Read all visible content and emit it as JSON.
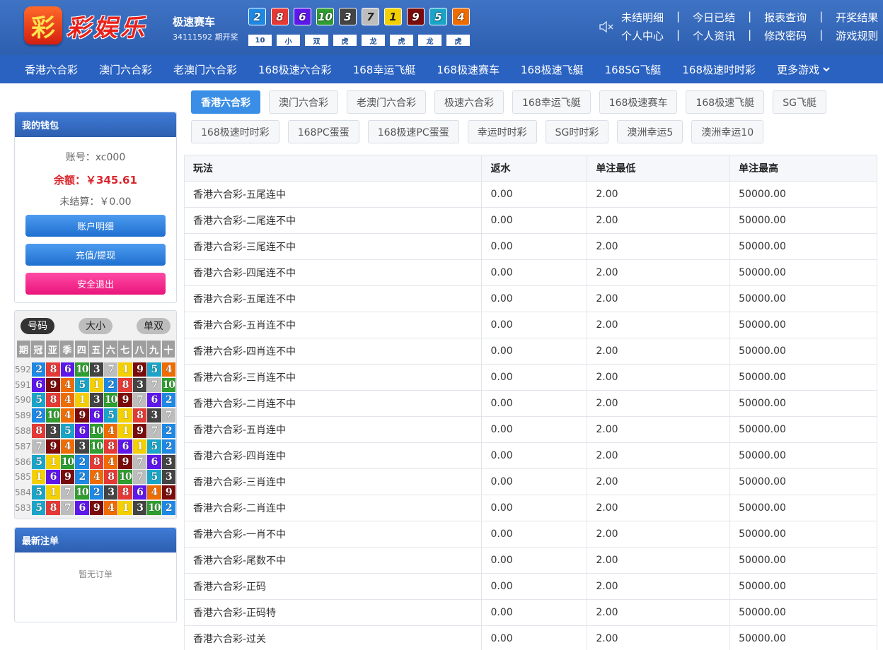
{
  "header": {
    "logo_char": "彩",
    "logo_text": "彩娱乐",
    "game_title": "极速赛车",
    "issue_text": "34111592 期开奖",
    "balls": [
      {
        "n": "2",
        "c": "#1e88e5"
      },
      {
        "n": "8",
        "c": "#e53935"
      },
      {
        "n": "6",
        "c": "#5e17eb"
      },
      {
        "n": "10",
        "c": "#2e9e2e"
      },
      {
        "n": "3",
        "c": "#444444"
      },
      {
        "n": "7",
        "c": "#bdbdbd"
      },
      {
        "n": "1",
        "c": "#f5d000"
      },
      {
        "n": "9",
        "c": "#7b0b0b"
      },
      {
        "n": "5",
        "c": "#1aa5c8"
      },
      {
        "n": "4",
        "c": "#ef6c00"
      }
    ],
    "stats": [
      "10",
      "小",
      "双",
      "虎",
      "龙",
      "虎",
      "龙",
      "虎"
    ],
    "links_row1": [
      "未结明细",
      "今日已结",
      "报表查询",
      "开奖结果"
    ],
    "links_row2": [
      "个人中心",
      "个人资讯",
      "修改密码",
      "游戏规则"
    ]
  },
  "nav": [
    "香港六合彩",
    "澳门六合彩",
    "老澳门六合彩",
    "168极速六合彩",
    "168幸运飞艇",
    "168极速赛车",
    "168极速飞艇",
    "168SG飞艇",
    "168极速时时彩"
  ],
  "nav_more": "更多游戏",
  "wallet": {
    "title": "我的钱包",
    "account": "账号：xc000",
    "balance": "余额：￥345.61",
    "unsettled": "未结算：￥0.00",
    "btn_detail": "账户明细",
    "btn_recharge": "充值/提现",
    "btn_logout": "安全退出"
  },
  "trend": {
    "tabs": [
      "号码",
      "大小",
      "单双"
    ],
    "headers": [
      "期",
      "冠",
      "亚",
      "季",
      "四",
      "五",
      "六",
      "七",
      "八",
      "九",
      "十"
    ],
    "rows": [
      {
        "p": "592",
        "v": [
          2,
          8,
          6,
          10,
          3,
          7,
          1,
          9,
          5,
          4
        ]
      },
      {
        "p": "591",
        "v": [
          6,
          9,
          4,
          5,
          1,
          2,
          8,
          3,
          7,
          10
        ]
      },
      {
        "p": "590",
        "v": [
          5,
          8,
          4,
          1,
          3,
          10,
          9,
          7,
          6,
          2
        ]
      },
      {
        "p": "589",
        "v": [
          2,
          10,
          4,
          9,
          6,
          5,
          1,
          8,
          3,
          7
        ]
      },
      {
        "p": "588",
        "v": [
          8,
          3,
          5,
          6,
          10,
          4,
          1,
          9,
          7,
          2
        ]
      },
      {
        "p": "587",
        "v": [
          7,
          9,
          4,
          3,
          10,
          8,
          6,
          1,
          5,
          2
        ]
      },
      {
        "p": "586",
        "v": [
          5,
          1,
          10,
          2,
          8,
          4,
          9,
          7,
          6,
          3
        ]
      },
      {
        "p": "585",
        "v": [
          1,
          6,
          9,
          2,
          4,
          8,
          10,
          7,
          5,
          3
        ]
      },
      {
        "p": "584",
        "v": [
          5,
          1,
          7,
          10,
          2,
          3,
          8,
          6,
          4,
          9
        ]
      },
      {
        "p": "583",
        "v": [
          5,
          8,
          7,
          6,
          9,
          4,
          1,
          3,
          10,
          2
        ]
      }
    ],
    "colors": {
      "1": "#f5d000",
      "2": "#1e88e5",
      "3": "#444444",
      "4": "#ef6c00",
      "5": "#1aa5c8",
      "6": "#5e17eb",
      "7": "#bdbdbd",
      "8": "#e53935",
      "9": "#7b0b0b",
      "10": "#2e9e2e"
    }
  },
  "orders": {
    "title": "最新注单",
    "empty": "暂无订单"
  },
  "tabs": [
    "香港六合彩",
    "澳门六合彩",
    "老澳门六合彩",
    "极速六合彩",
    "168幸运飞艇",
    "168极速赛车",
    "168极速飞艇",
    "SG飞艇",
    "168极速时时彩",
    "168PC蛋蛋",
    "168极速PC蛋蛋",
    "幸运时时彩",
    "SG时时彩",
    "澳洲幸运5",
    "澳洲幸运10"
  ],
  "table": {
    "headers": [
      "玩法",
      "返水",
      "单注最低",
      "单注最高"
    ],
    "rows": [
      [
        "香港六合彩-五尾连中",
        "0.00",
        "2.00",
        "50000.00"
      ],
      [
        "香港六合彩-二尾连不中",
        "0.00",
        "2.00",
        "50000.00"
      ],
      [
        "香港六合彩-三尾连不中",
        "0.00",
        "2.00",
        "50000.00"
      ],
      [
        "香港六合彩-四尾连不中",
        "0.00",
        "2.00",
        "50000.00"
      ],
      [
        "香港六合彩-五尾连不中",
        "0.00",
        "2.00",
        "50000.00"
      ],
      [
        "香港六合彩-五肖连不中",
        "0.00",
        "2.00",
        "50000.00"
      ],
      [
        "香港六合彩-四肖连不中",
        "0.00",
        "2.00",
        "50000.00"
      ],
      [
        "香港六合彩-三肖连不中",
        "0.00",
        "2.00",
        "50000.00"
      ],
      [
        "香港六合彩-二肖连不中",
        "0.00",
        "2.00",
        "50000.00"
      ],
      [
        "香港六合彩-五肖连中",
        "0.00",
        "2.00",
        "50000.00"
      ],
      [
        "香港六合彩-四肖连中",
        "0.00",
        "2.00",
        "50000.00"
      ],
      [
        "香港六合彩-三肖连中",
        "0.00",
        "2.00",
        "50000.00"
      ],
      [
        "香港六合彩-二肖连中",
        "0.00",
        "2.00",
        "50000.00"
      ],
      [
        "香港六合彩-一肖不中",
        "0.00",
        "2.00",
        "50000.00"
      ],
      [
        "香港六合彩-尾数不中",
        "0.00",
        "2.00",
        "50000.00"
      ],
      [
        "香港六合彩-正码",
        "0.00",
        "2.00",
        "50000.00"
      ],
      [
        "香港六合彩-正码特",
        "0.00",
        "2.00",
        "50000.00"
      ],
      [
        "香港六合彩-过关",
        "0.00",
        "2.00",
        "50000.00"
      ]
    ]
  }
}
